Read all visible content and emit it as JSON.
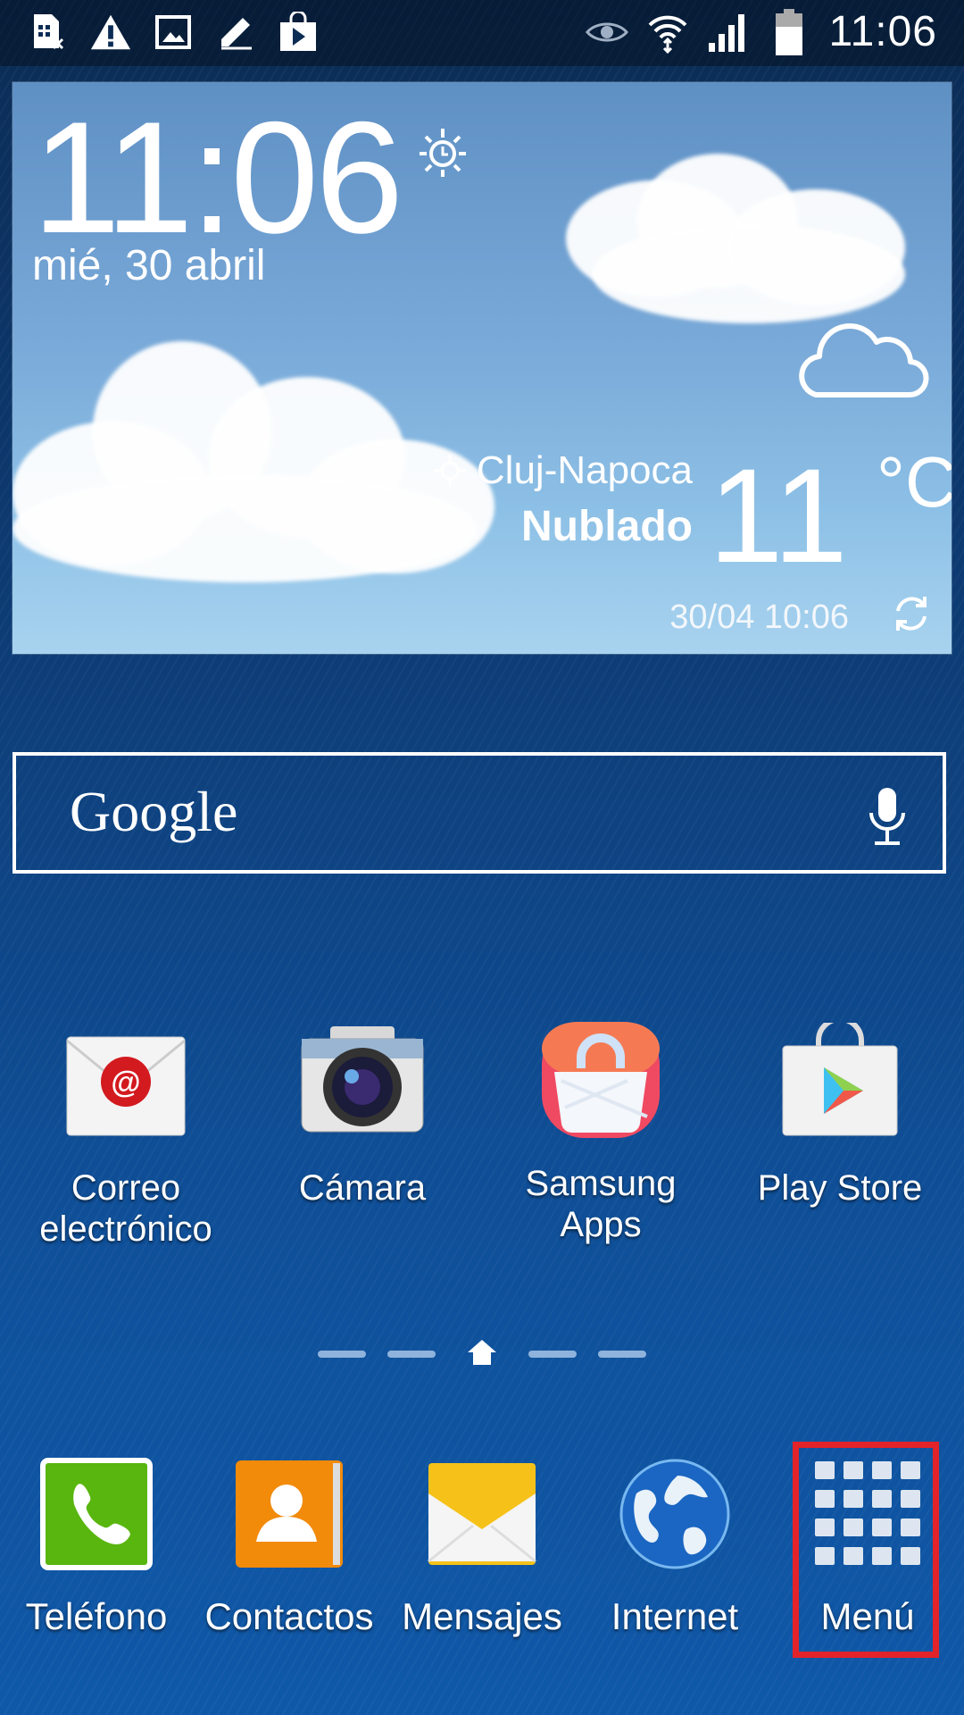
{
  "status_bar": {
    "left_icons": [
      "sim-off-icon",
      "warning-icon",
      "image-icon",
      "pencil-icon",
      "play-store-bag-icon"
    ],
    "right_icons": [
      "eye-icon",
      "wifi-icon",
      "signal-icon",
      "battery-icon"
    ],
    "time": "11:06"
  },
  "weather_widget": {
    "time": "11:06",
    "date": "mié, 30 abril",
    "city": "Cluj-Napoca",
    "condition": "Nublado",
    "temperature": "11",
    "unit": "°C",
    "updated": "30/04 10:06"
  },
  "search": {
    "logo": "Google"
  },
  "apps": [
    {
      "label": "Correo\nelectrónico"
    },
    {
      "label": "Cámara"
    },
    {
      "label": "Samsung\nApps"
    },
    {
      "label": "Play Store"
    }
  ],
  "dock": [
    {
      "label": "Teléfono"
    },
    {
      "label": "Contactos"
    },
    {
      "label": "Mensajes"
    },
    {
      "label": "Internet"
    },
    {
      "label": "Menú"
    }
  ],
  "colors": {
    "highlight": "#e2232a",
    "phone_green": "#58b60e",
    "contacts_orange": "#f28a0a",
    "messages_yellow": "#f6c21a"
  }
}
